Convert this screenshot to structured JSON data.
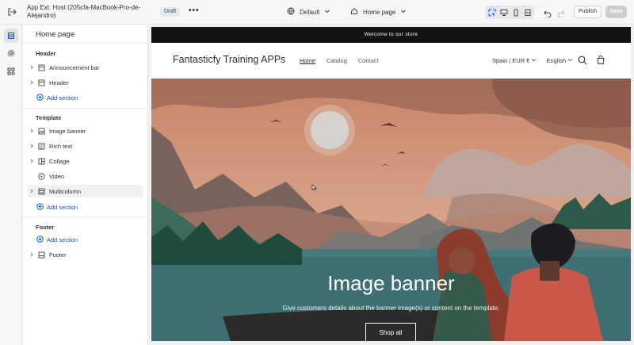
{
  "topbar": {
    "app_title": "App Ext. Host (205cfa-MacBook-Pro-de-Alejandro)",
    "status": "Draft",
    "more": "•••",
    "theme": "Default",
    "page": "Home page",
    "publish_label": "Publish",
    "save_label": "Save"
  },
  "sidebar": {
    "title": "Home page",
    "header_group": "Header",
    "header_items": [
      "Announcement bar",
      "Header"
    ],
    "template_group": "Template",
    "template_items": [
      "Image banner",
      "Rich text",
      "Collage",
      "Video",
      "Multicolumn"
    ],
    "footer_group": "Footer",
    "footer_items": [
      "Footer"
    ],
    "add_section": "Add section"
  },
  "store": {
    "announcement": "Welcome to our store",
    "logo": "Fantasticfy Training APPs",
    "nav": [
      "Home",
      "Catalog",
      "Contact"
    ],
    "currency": "Spain | EUR €",
    "language": "English",
    "banner_heading": "Image banner",
    "banner_sub": "Give customers details about the banner image(s) or content on the template.",
    "banner_button": "Shop all"
  },
  "colors": {
    "accent": "#005bd3",
    "sky": "#c98a6e",
    "water": "#3f6f72"
  }
}
